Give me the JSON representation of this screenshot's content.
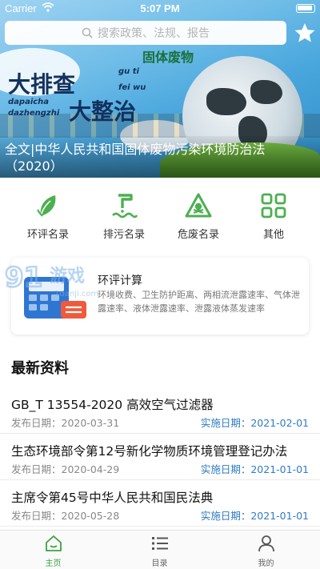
{
  "status_bar": {
    "carrier": "Carrier",
    "time": "5:07 PM"
  },
  "search": {
    "placeholder": "搜索政策、法规、报告"
  },
  "banner": {
    "slogan_top": "固体废物",
    "slogan_left": "大排查",
    "slogan_right": "大整治",
    "pinyin_1": "dapaicha",
    "pinyin_2": "dazhengzhi",
    "pinyin_3": "gu ti",
    "pinyin_4": "fei wu",
    "caption": "全文|中华人民共和国固体废物污染环境防治法（2020）"
  },
  "quick_menu": [
    {
      "label": "环评名录",
      "icon": "leaf-icon"
    },
    {
      "label": "排污名录",
      "icon": "discharge-pipe-icon"
    },
    {
      "label": "危废名录",
      "icon": "hazard-icon"
    },
    {
      "label": "其他",
      "icon": "grid-icon"
    }
  ],
  "calc_card": {
    "title": "环评计算",
    "desc": "环境收费、卫生防护距离、两相流泄露速率、气体泄露速率、液体泄露速率、泄露液体蒸发速率"
  },
  "watermark": {
    "text": "游戏",
    "site": "1danji.com"
  },
  "latest": {
    "title": "最新资料",
    "items": [
      {
        "title": "GB_T 13554-2020 高效空气过滤器",
        "publish": "发布日期：2020-03-31",
        "implement": "实施日期：2021-02-01"
      },
      {
        "title": "生态环境部令第12号新化学物质环境管理登记办法",
        "publish": "发布日期：2020-04-29",
        "implement": "实施日期：2021-01-01"
      },
      {
        "title": "主席令第45号中华人民共和国民法典",
        "publish": "发布日期：2020-05-28",
        "implement": "实施日期：2021-01-01"
      }
    ]
  },
  "tabs": [
    {
      "label": "主页",
      "icon": "home-icon",
      "active": true
    },
    {
      "label": "目录",
      "icon": "list-icon",
      "active": false
    },
    {
      "label": "我的",
      "icon": "user-icon",
      "active": false
    }
  ],
  "colors": {
    "accent": "#3aa33f",
    "link": "#2f7cc4",
    "banner_blue": "#4aa7dd"
  }
}
